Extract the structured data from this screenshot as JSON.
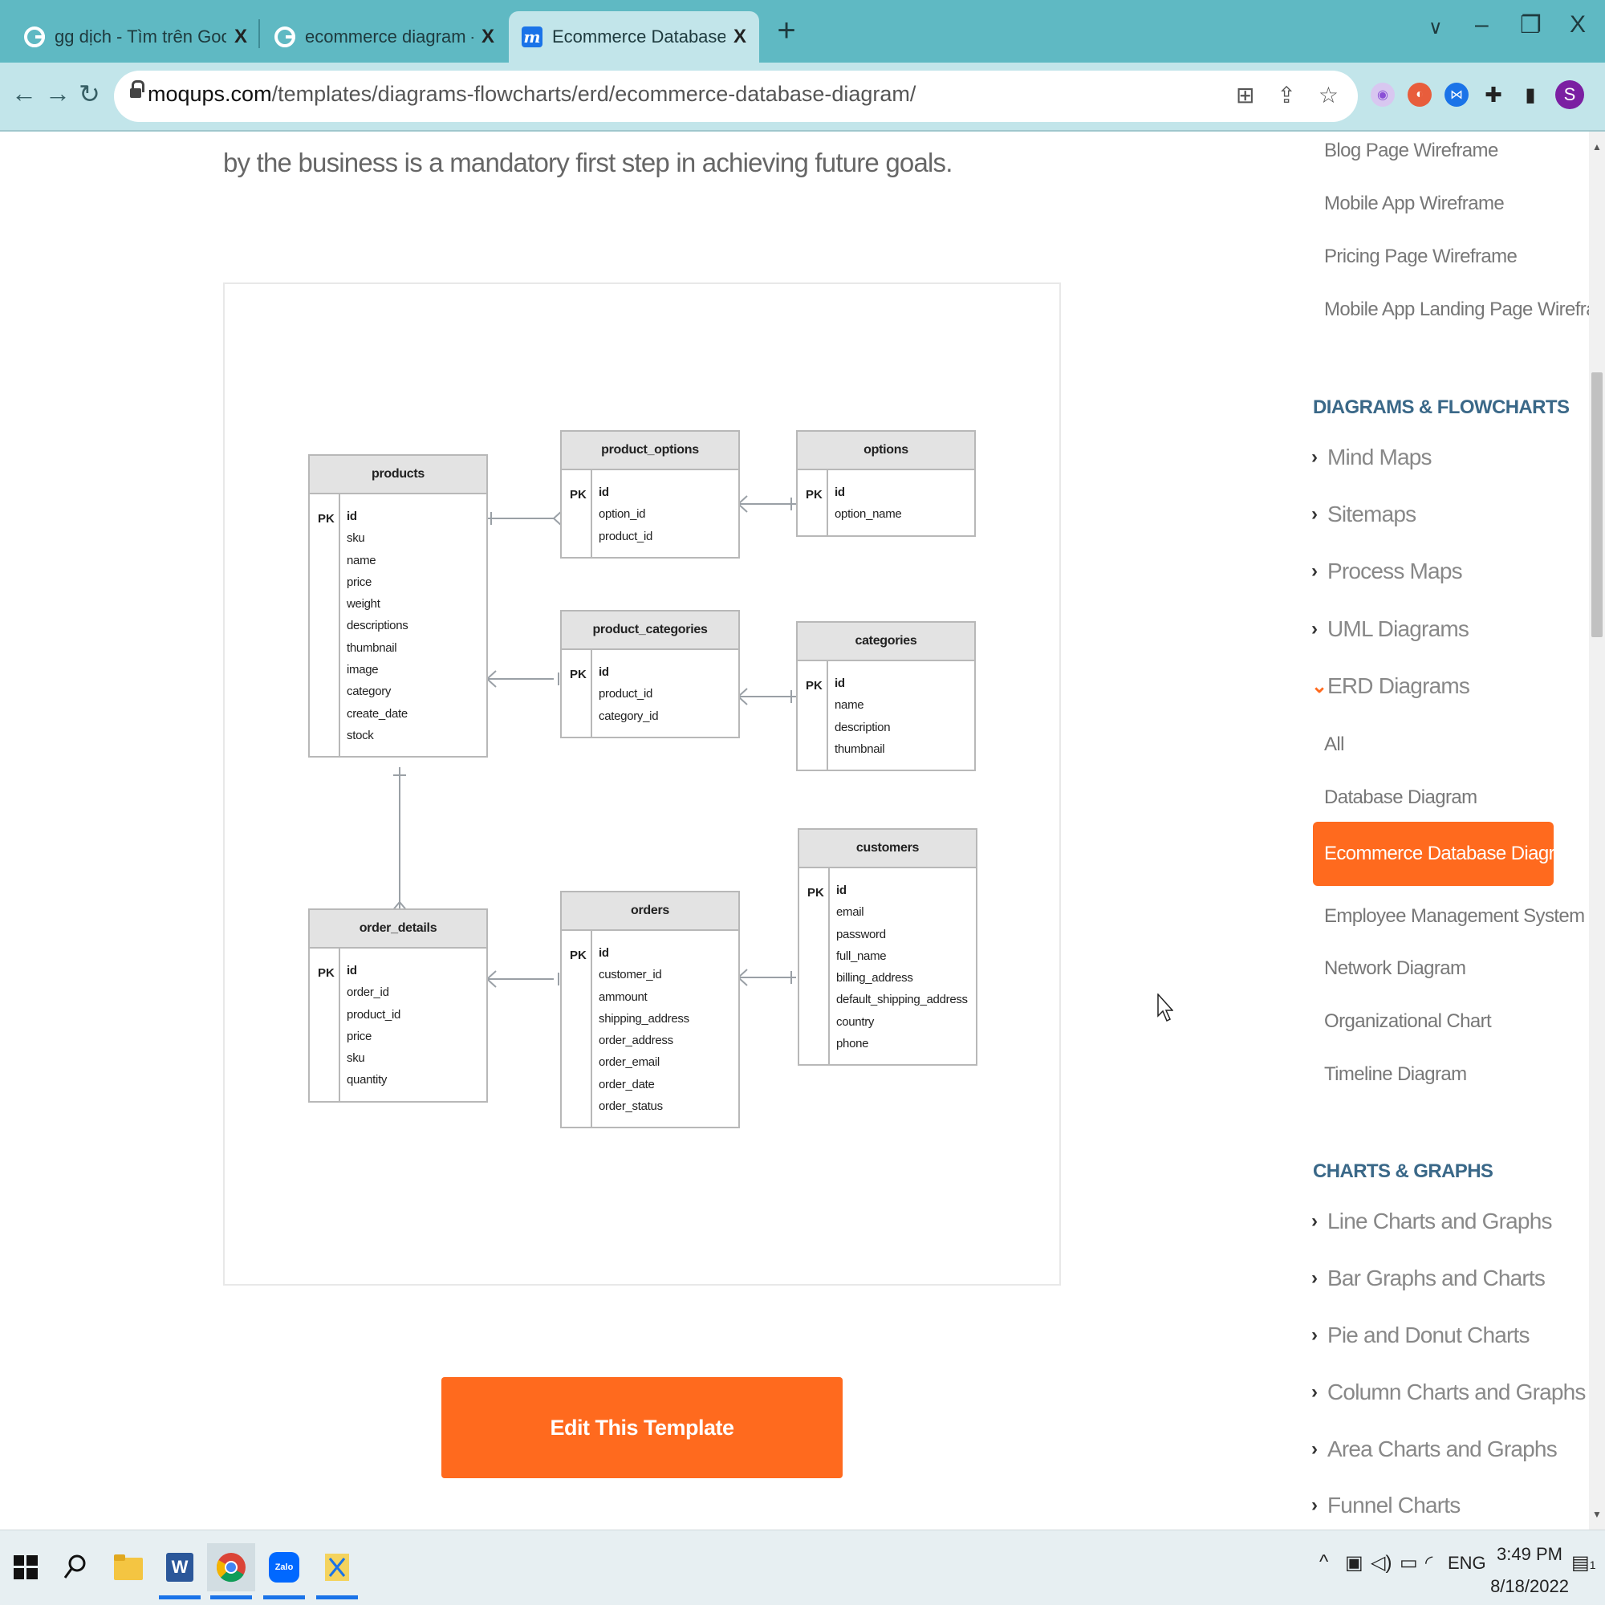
{
  "browser": {
    "tabs": [
      {
        "title": "gg dịch - Tìm trên Google",
        "icon": "google-icon",
        "close": "X"
      },
      {
        "title": "ecommerce diagram - Tìm trên Google",
        "icon": "google-icon",
        "close": "X"
      },
      {
        "title": "Ecommerce Database Diagram Template",
        "icon": "moqups-icon",
        "close": "X",
        "active": true
      }
    ],
    "new_tab": "+",
    "window_controls": {
      "tab_search": "∨",
      "minimize": "–",
      "restore": "❐",
      "close": "X"
    },
    "url_host": "moqups.com",
    "url_path": "/templates/diagrams-flowcharts/erd/ecommerce-database-diagram/",
    "profile_initial": "S"
  },
  "page": {
    "intro_text": "by the business is a mandatory first step in achieving future goals.",
    "edit_button_label": "Edit This Template"
  },
  "erd": {
    "pk_label": "PK",
    "tables": {
      "products": {
        "name": "products",
        "fields": [
          "id",
          "sku",
          "name",
          "price",
          "weight",
          "descriptions",
          "thumbnail",
          "image",
          "category",
          "create_date",
          "stock"
        ]
      },
      "product_options": {
        "name": "product_options",
        "fields": [
          "id",
          "option_id",
          "product_id"
        ]
      },
      "options": {
        "name": "options",
        "fields": [
          "id",
          "option_name"
        ]
      },
      "product_categories": {
        "name": "product_categories",
        "fields": [
          "id",
          "product_id",
          "category_id"
        ]
      },
      "categories": {
        "name": "categories",
        "fields": [
          "id",
          "name",
          "description",
          "thumbnail"
        ]
      },
      "customers": {
        "name": "customers",
        "fields": [
          "id",
          "email",
          "password",
          "full_name",
          "billing_address",
          "default_shipping_address",
          "country",
          "phone"
        ]
      },
      "order_details": {
        "name": "order_details",
        "fields": [
          "id",
          "order_id",
          "product_id",
          "price",
          "sku",
          "quantity"
        ]
      },
      "orders": {
        "name": "orders",
        "fields": [
          "id",
          "customer_id",
          "ammount",
          "shipping_address",
          "order_address",
          "order_email",
          "order_date",
          "order_status"
        ]
      }
    }
  },
  "sidebar": {
    "wireframe_links": [
      "Blog Page Wireframe",
      "Mobile App Wireframe",
      "Pricing Page Wireframe",
      "Mobile App Landing Page Wireframe"
    ],
    "diagrams_heading": "DIAGRAMS & FLOWCHARTS",
    "diagram_categories": [
      "Mind Maps",
      "Sitemaps",
      "Process Maps",
      "UML Diagrams",
      "ERD Diagrams"
    ],
    "erd_items": [
      "All",
      "Database Diagram",
      "Ecommerce Database Diagram",
      "Employee Management System ERD",
      "Network Diagram",
      "Organizational Chart",
      "Timeline Diagram"
    ],
    "charts_heading": "CHARTS & GRAPHS",
    "chart_categories": [
      "Line Charts and Graphs",
      "Bar Graphs and Charts",
      "Pie and Donut Charts",
      "Column Charts and Graphs",
      "Area Charts and Graphs",
      "Funnel Charts"
    ]
  },
  "taskbar": {
    "apps": [
      "windows-start-icon",
      "search-icon",
      "file-explorer-icon",
      "word-icon",
      "chrome-icon",
      "zalo-icon",
      "snipping-tool-icon"
    ],
    "zalo_label": "Zalo",
    "word_label": "W",
    "language": "ENG",
    "time": "3:49 PM",
    "date": "8/18/2022",
    "notification_count": "1"
  },
  "colors": {
    "accent": "#ff6a1e",
    "tabbar": "#5fb9c3",
    "heading": "#3a6888"
  }
}
